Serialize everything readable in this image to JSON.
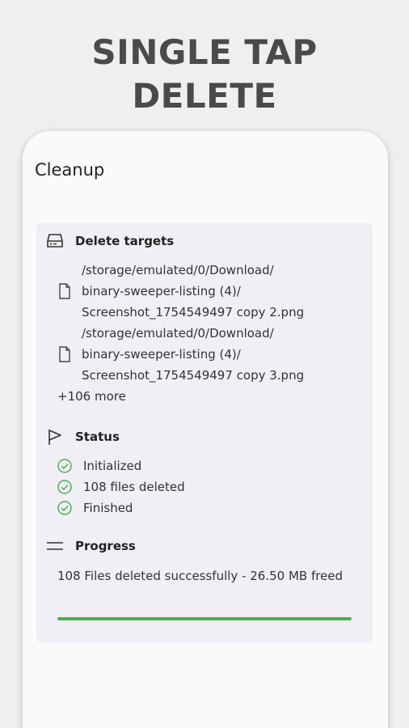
{
  "headline": {
    "line1": "SINGLE TAP",
    "line2": "DELETE"
  },
  "app": {
    "title": "Cleanup"
  },
  "delete_targets": {
    "label": "Delete targets",
    "icon": "drive-icon",
    "items": [
      {
        "line1": "/storage/emulated/0/Download/",
        "line2": "binary-sweeper-listing (4)/",
        "line3": "Screenshot_1754549497 copy 2.png"
      },
      {
        "line1": "/storage/emulated/0/Download/",
        "line2": "binary-sweeper-listing (4)/",
        "line3": "Screenshot_1754549497 copy 3.png"
      }
    ],
    "more": "+106 more"
  },
  "status": {
    "label": "Status",
    "icon": "flag-icon",
    "items": [
      "Initialized",
      "108 files deleted",
      "Finished"
    ],
    "check_color": "#4caf50"
  },
  "progress": {
    "label": "Progress",
    "icon": "menu-lines-icon",
    "text": "108 Files deleted successfully - 26.50 MB freed",
    "fraction": 1.0,
    "bar_color": "#4caf50"
  }
}
